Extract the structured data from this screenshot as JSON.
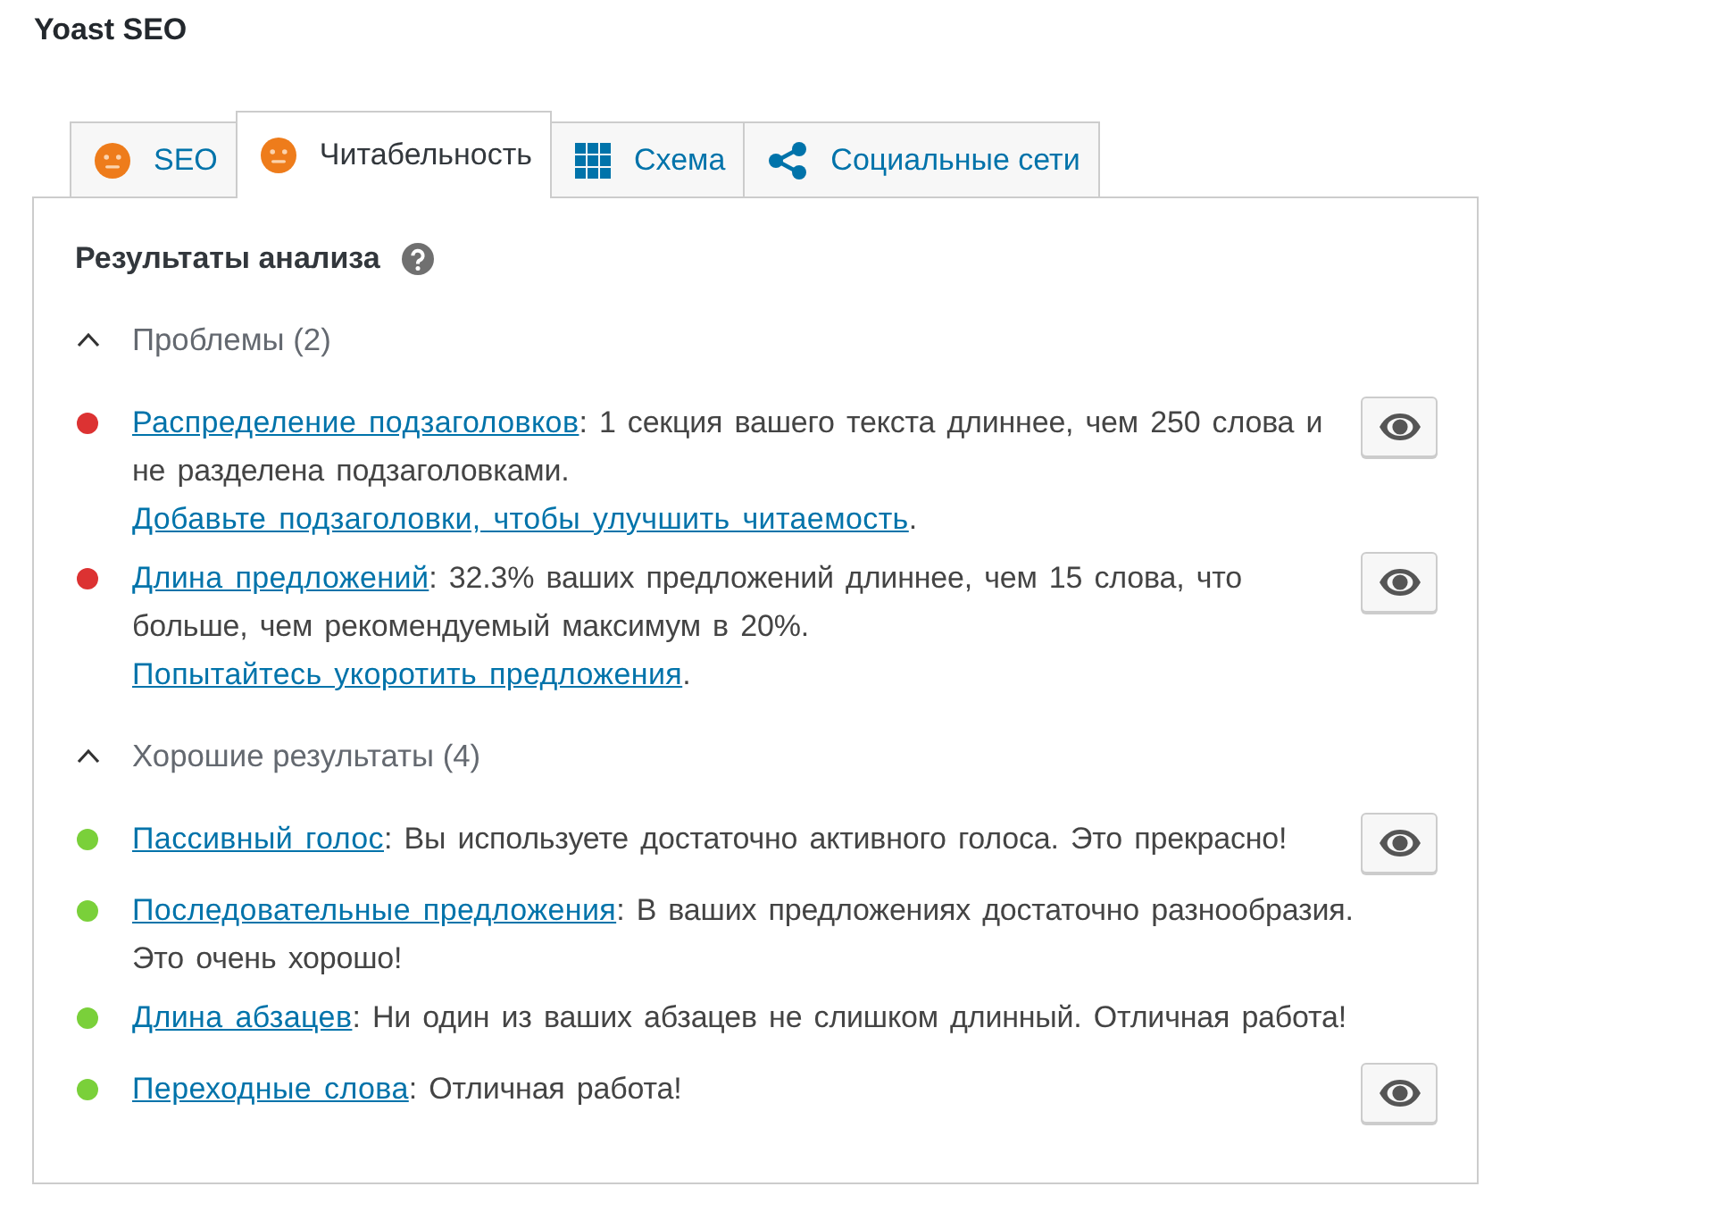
{
  "title": "Yoast SEO",
  "tabs": [
    {
      "label": "SEO",
      "kind": "score",
      "color": "#ee7c1b",
      "selected": false
    },
    {
      "label": "Читабельность",
      "kind": "score",
      "color": "#ee7c1b",
      "selected": true
    },
    {
      "label": "Схема",
      "kind": "schema",
      "selected": false
    },
    {
      "label": "Социальные сети",
      "kind": "social",
      "selected": false
    }
  ],
  "panel": {
    "heading": "Результаты анализа",
    "sections": [
      {
        "label": "Проблемы (2)",
        "expanded": true,
        "items": [
          {
            "color": "#dc3232",
            "segments": [
              {
                "kind": "link",
                "text": "Распределение подзаголовков"
              },
              {
                "kind": "text",
                "text": ": 1 секция вашего текста длиннее, чем 250 слова и не разделена подзаголовками. "
              },
              {
                "kind": "link",
                "text": "Добавьте подзаголовки, чтобы улучшить читаемость"
              },
              {
                "kind": "text",
                "text": "."
              }
            ],
            "marker_button": true
          },
          {
            "color": "#dc3232",
            "segments": [
              {
                "kind": "link",
                "text": "Длина предложений"
              },
              {
                "kind": "text",
                "text": ": 32.3% ваших предложений длиннее, чем 15 слова, что больше, чем рекомендуемый максимум в 20%. "
              },
              {
                "kind": "link",
                "text": "Попытайтесь укоротить предложения"
              },
              {
                "kind": "text",
                "text": "."
              }
            ],
            "marker_button": true
          }
        ]
      },
      {
        "label": "Хорошие результаты (4)",
        "expanded": true,
        "items": [
          {
            "color": "#7ad03a",
            "segments": [
              {
                "kind": "link",
                "text": "Пассивный голос"
              },
              {
                "kind": "text",
                "text": ": Вы используете достаточно активного голоса. Это прекрасно!"
              }
            ],
            "marker_button": true
          },
          {
            "color": "#7ad03a",
            "segments": [
              {
                "kind": "link",
                "text": "Последовательные предложения"
              },
              {
                "kind": "text",
                "text": ": В ваших предложениях достаточно разнообразия. Это очень хорошо!"
              }
            ],
            "marker_button": false
          },
          {
            "color": "#7ad03a",
            "segments": [
              {
                "kind": "link",
                "text": "Длина абзацев"
              },
              {
                "kind": "text",
                "text": ": Ни один из ваших абзацев не слишком длинный. Отличная работа!"
              }
            ],
            "marker_button": false
          },
          {
            "color": "#7ad03a",
            "segments": [
              {
                "kind": "link",
                "text": "Переходные слова"
              },
              {
                "kind": "text",
                "text": ": Отличная работа!"
              }
            ],
            "marker_button": true
          }
        ]
      }
    ]
  }
}
